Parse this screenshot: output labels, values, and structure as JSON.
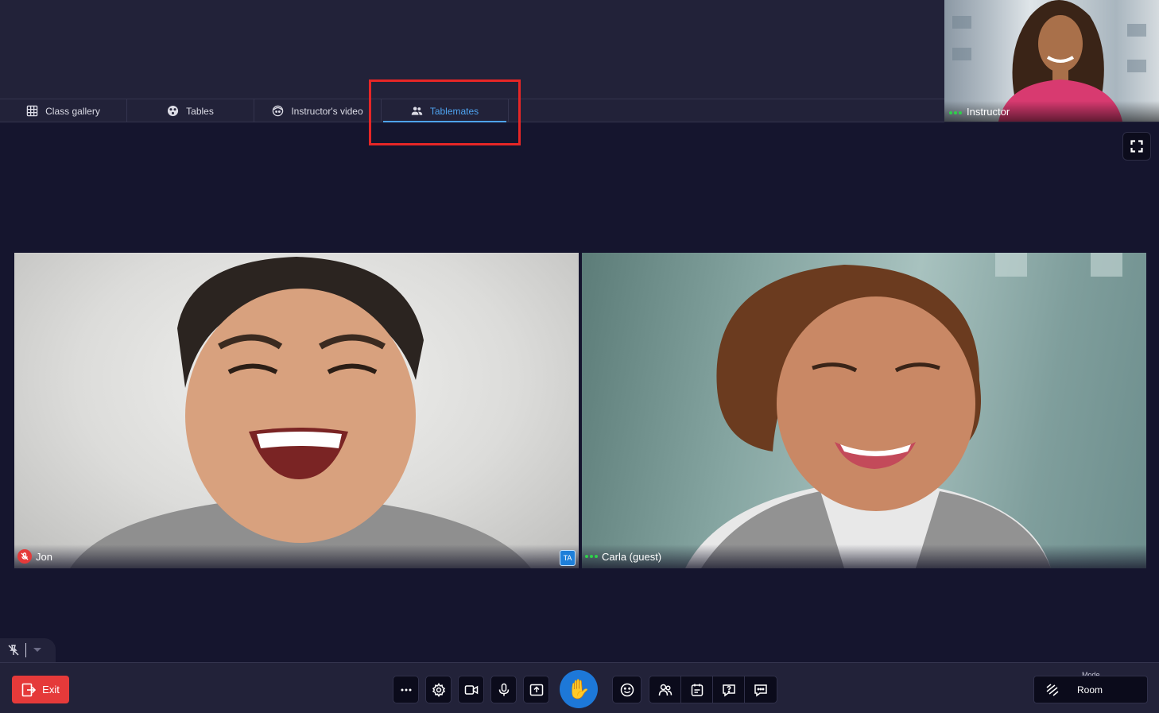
{
  "tabs": [
    {
      "label": "Class gallery",
      "icon": "grid-icon"
    },
    {
      "label": "Tables",
      "icon": "tables-icon"
    },
    {
      "label": "Instructor's video",
      "icon": "instructor-face-icon"
    },
    {
      "label": "Tablemates",
      "icon": "people-icon",
      "active": true
    }
  ],
  "instructor": {
    "label": "Instructor"
  },
  "participants": [
    {
      "name": "Jon",
      "muted": true,
      "badge": "TA"
    },
    {
      "name": "Carla (guest)",
      "muted": false
    }
  ],
  "bottombar": {
    "exit_label": "Exit",
    "mode_label": "Mode",
    "mode_value": "Room"
  },
  "colors": {
    "accent": "#4ea3f0",
    "exit": "#e53a3a",
    "raise_hand": "#1d78d8",
    "highlight": "#e62626",
    "background": "#15152e"
  }
}
